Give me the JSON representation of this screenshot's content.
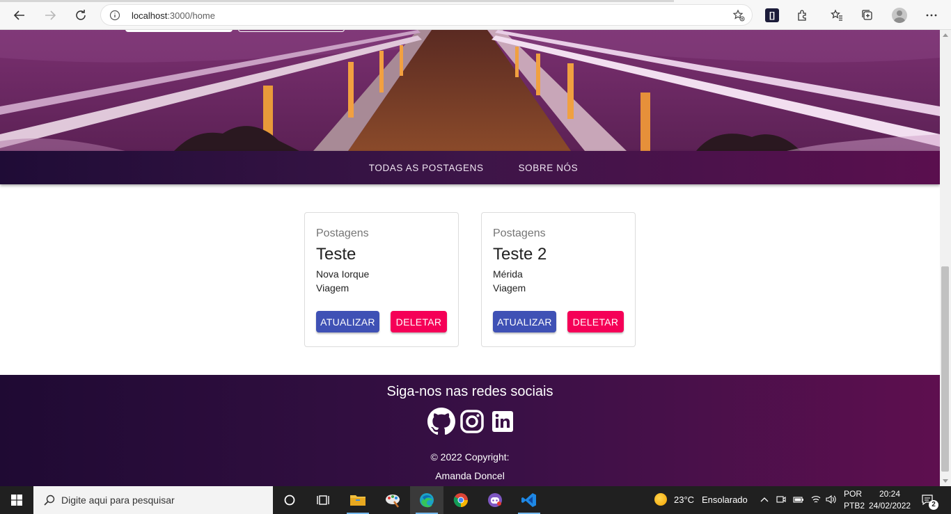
{
  "browser": {
    "url_host": "localhost",
    "url_path": ":3000/home",
    "ext_label": "[]"
  },
  "navbar": {
    "links": [
      "TODAS AS POSTAGENS",
      "SOBRE NÓS"
    ]
  },
  "cards": [
    {
      "category": "Postagens",
      "title": "Teste",
      "description": "Nova Iorque",
      "theme": "Viagem",
      "update_label": "ATUALIZAR",
      "delete_label": "DELETAR"
    },
    {
      "category": "Postagens",
      "title": "Teste 2",
      "description": "Mérida",
      "theme": "Viagem",
      "update_label": "ATUALIZAR",
      "delete_label": "DELETAR"
    }
  ],
  "footer": {
    "follow_text": "Siga-nos nas redes sociais",
    "social_icons": [
      "github-icon",
      "instagram-icon",
      "linkedin-icon"
    ],
    "copyright": "© 2022 Copyright:",
    "author": "Amanda Doncel"
  },
  "colors": {
    "update_button": "#3f51b5",
    "delete_button": "#f50057",
    "nav_gradient_start": "#1f0c36",
    "nav_gradient_end": "#5a0f4e"
  },
  "taskbar": {
    "search_placeholder": "Digite aqui para pesquisar",
    "weather_temp": "23°C",
    "weather_desc": "Ensolarado",
    "lang_line1": "POR",
    "lang_line2": "PTB2",
    "time": "20:24",
    "date": "24/02/2022",
    "notification_count": "2"
  }
}
